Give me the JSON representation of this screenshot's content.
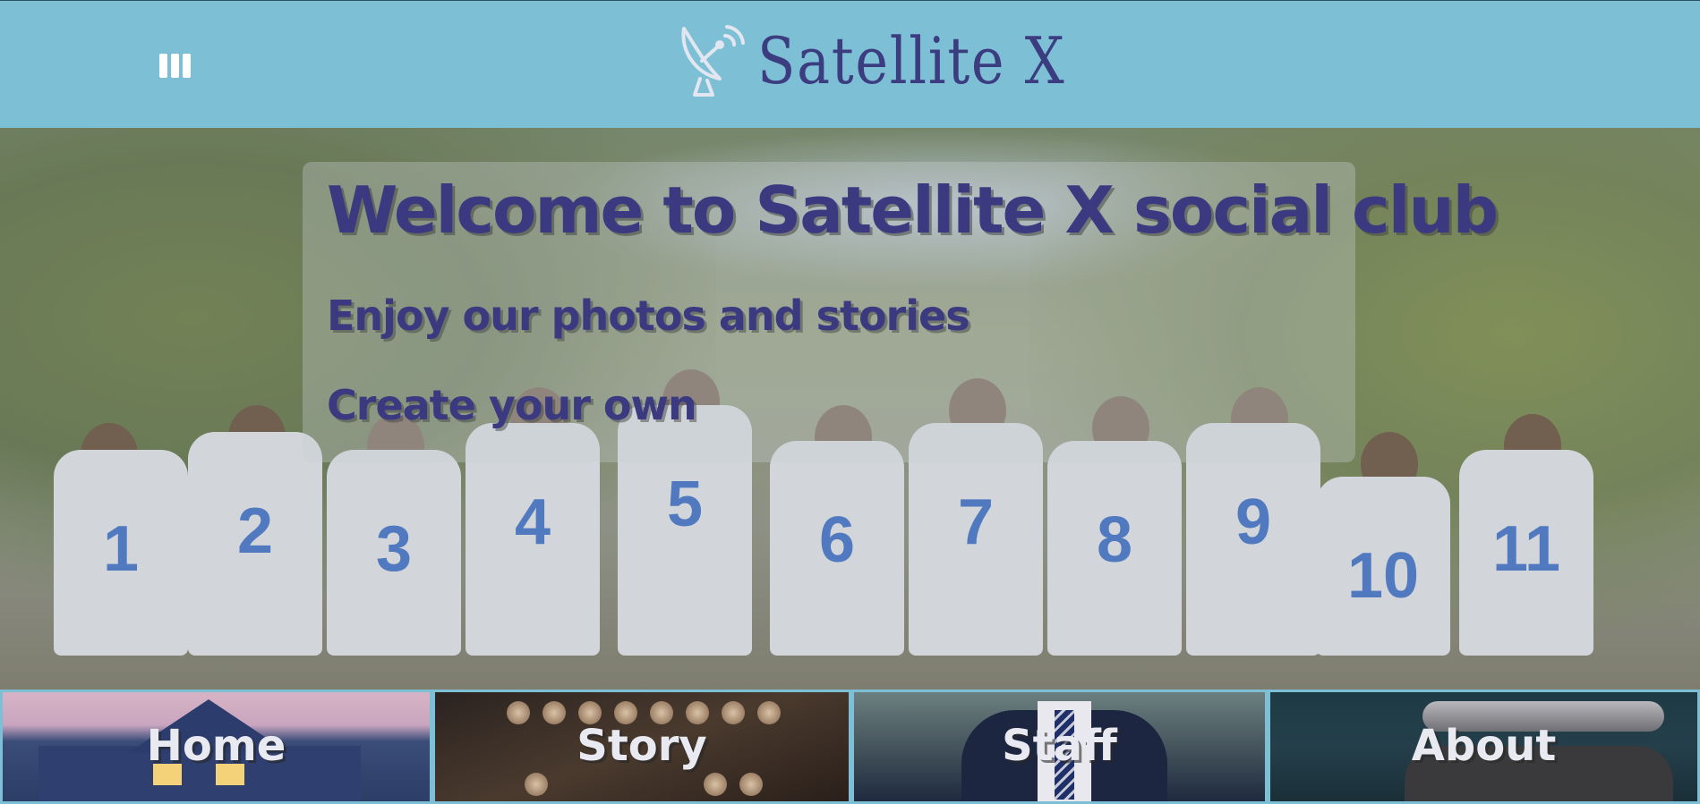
{
  "header": {
    "menu_label": "",
    "brand": "Satellite X"
  },
  "hero": {
    "title": "Welcome to Satellite X social club",
    "line1": "Enjoy our photos and stories",
    "line2": "Create your own",
    "shirt_numbers": [
      "1",
      "2",
      "3",
      "4",
      "5",
      "6",
      "7",
      "8",
      "9",
      "10",
      "11"
    ]
  },
  "nav": {
    "tiles": [
      {
        "label": "Home"
      },
      {
        "label": "Story"
      },
      {
        "label": "Staff"
      },
      {
        "label": "About"
      }
    ]
  },
  "colors": {
    "header_bg": "#7dc0d6",
    "brand_text": "#3c3c80",
    "title_text": "#3b3a80"
  },
  "icons": {
    "menu": "menu-icon",
    "logo": "satellite-dish-icon"
  }
}
